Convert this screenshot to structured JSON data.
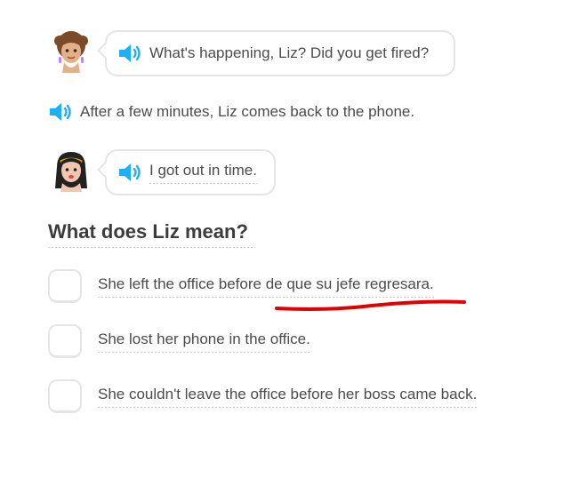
{
  "dialogue": [
    {
      "speaker_icon": "speaker-icon",
      "text": "What's happening, Liz? Did you get fired?"
    },
    {
      "speaker_icon": "speaker-icon",
      "text": "I got out in time."
    }
  ],
  "narration": {
    "text": "After a few minutes, Liz comes back to the phone."
  },
  "question": "What does Liz mean?",
  "options": [
    {
      "label": "She left the office before de que su jefe regresara.",
      "checked": false
    },
    {
      "label": "She lost her phone in the office.",
      "checked": false
    },
    {
      "label": "She couldn't leave the office before her boss came back.",
      "checked": false
    }
  ],
  "colors": {
    "speaker": "#1cb0f6",
    "annotation": "#e00000",
    "border": "#e5e5e5"
  }
}
